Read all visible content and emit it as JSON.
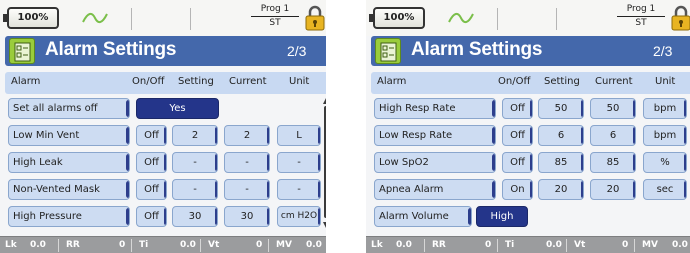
{
  "left": {
    "battery": "100%",
    "prog_line1": "Prog 1",
    "prog_line2": "ST",
    "title": "Alarm Settings",
    "page": "2/3",
    "headers": {
      "alarm": "Alarm",
      "onoff": "On/Off",
      "setting": "Setting",
      "current": "Current",
      "unit": "Unit"
    },
    "set_all": {
      "label": "Set all alarms off",
      "value": "Yes"
    },
    "rows": [
      {
        "label": "Low Min Vent",
        "onoff": "Off",
        "setting": "2",
        "current": "2",
        "unit": "L"
      },
      {
        "label": "High Leak",
        "onoff": "Off",
        "setting": "-",
        "current": "-",
        "unit": "-"
      },
      {
        "label": "Non-Vented Mask",
        "onoff": "Off",
        "setting": "-",
        "current": "-",
        "unit": "-"
      },
      {
        "label": "High Pressure",
        "onoff": "Off",
        "setting": "30",
        "current": "30",
        "unit": "cm H2O"
      }
    ],
    "status": {
      "lk": "Lk",
      "lk_val": "0.0",
      "rr": "RR",
      "rr_val": "0",
      "ti": "Ti",
      "ti_val": "0.0",
      "vt": "Vt",
      "vt_val": "0",
      "mv": "MV",
      "mv_val": "0.0"
    }
  },
  "right": {
    "battery": "100%",
    "prog_line1": "Prog 1",
    "prog_line2": "ST",
    "title": "Alarm Settings",
    "page": "2/3",
    "headers": {
      "alarm": "Alarm",
      "onoff": "On/Off",
      "setting": "Setting",
      "current": "Current",
      "unit": "Unit"
    },
    "rows": [
      {
        "label": "High Resp Rate",
        "onoff": "Off",
        "setting": "50",
        "current": "50",
        "unit": "bpm"
      },
      {
        "label": "Low Resp Rate",
        "onoff": "Off",
        "setting": "6",
        "current": "6",
        "unit": "bpm"
      },
      {
        "label": "Low SpO2",
        "onoff": "Off",
        "setting": "85",
        "current": "85",
        "unit": "%"
      },
      {
        "label": "Apnea Alarm",
        "onoff": "On",
        "setting": "20",
        "current": "20",
        "unit": "sec"
      }
    ],
    "volume": {
      "label": "Alarm Volume",
      "value": "High"
    },
    "status": {
      "lk": "Lk",
      "lk_val": "0.0",
      "rr": "RR",
      "rr_val": "0",
      "ti": "Ti",
      "ti_val": "0.0",
      "vt": "Vt",
      "vt_val": "0",
      "mv": "MV",
      "mv_val": "0.0"
    }
  },
  "colors": {
    "title_bar": "#4468ab",
    "selected": "#24358a",
    "button": "#cddcf2",
    "status_bar": "#9b9c9e",
    "icon_green": "#9acc3c",
    "lock": "#e8b422"
  },
  "icons": {
    "battery": "battery-icon",
    "waveform": "waveform-icon",
    "lock": "lock-icon",
    "alarm": "alarm-settings-icon"
  }
}
